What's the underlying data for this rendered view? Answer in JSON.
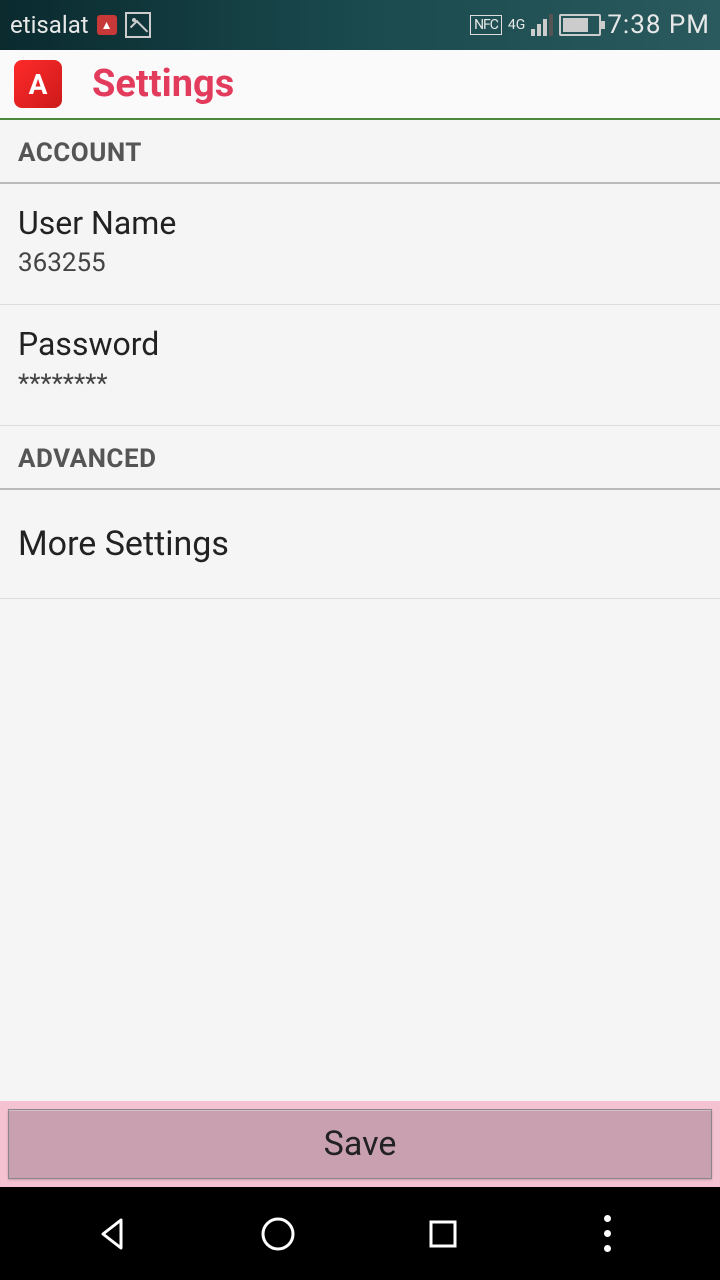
{
  "status": {
    "carrier": "etisalat",
    "nfc": "NFC",
    "network": "4G",
    "time": "7:38 PM"
  },
  "header": {
    "title": "Settings"
  },
  "sections": {
    "account": {
      "label": "ACCOUNT",
      "username": {
        "label": "User Name",
        "value": "363255"
      },
      "password": {
        "label": "Password",
        "value": "********"
      }
    },
    "advanced": {
      "label": "ADVANCED",
      "more": {
        "label": "More Settings"
      }
    }
  },
  "footer": {
    "save": "Save"
  }
}
